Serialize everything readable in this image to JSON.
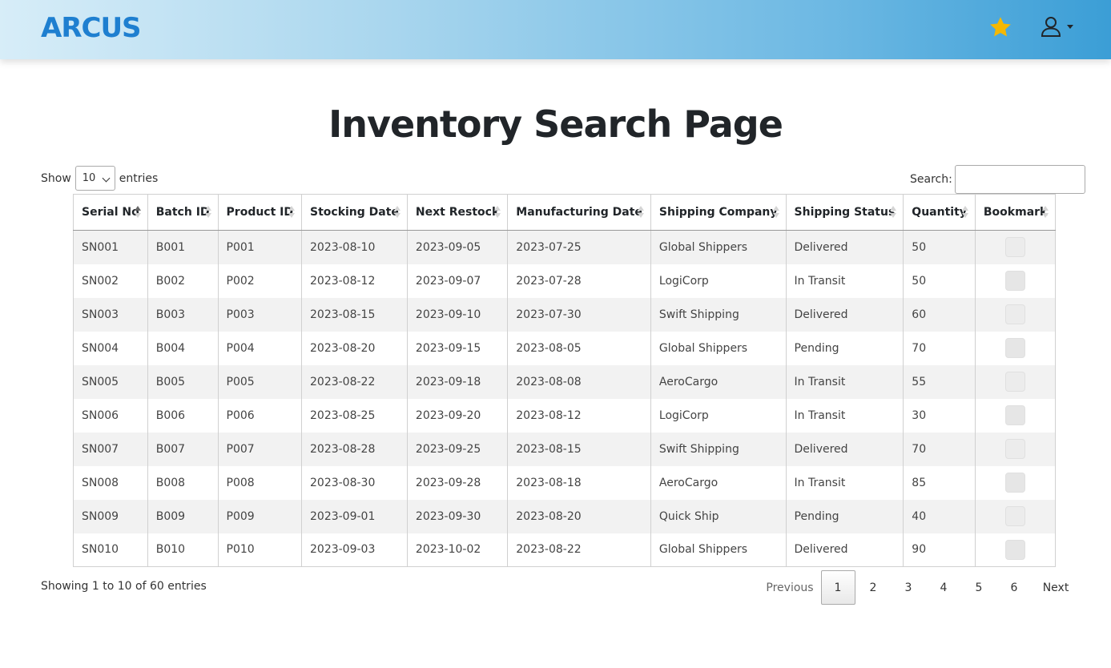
{
  "header": {
    "logo_text": "ARCUS",
    "star_color": "#f5b800",
    "icons": [
      "star-icon",
      "user-icon",
      "caret-down-icon"
    ]
  },
  "page": {
    "title": "Inventory Search Page"
  },
  "length": {
    "show_label": "Show",
    "selected": "10",
    "entries_label": "entries"
  },
  "search": {
    "label": "Search:",
    "value": ""
  },
  "table": {
    "columns": [
      "Serial No",
      "Batch ID",
      "Product ID",
      "Stocking Date",
      "Next Restock",
      "Manufacturing Date",
      "Shipping Company",
      "Shipping Status",
      "Quantity",
      "Bookmark"
    ],
    "sorted_column": "Serial No",
    "sort_direction": "ascending",
    "rows": [
      [
        "SN001",
        "B001",
        "P001",
        "2023-08-10",
        "2023-09-05",
        "2023-07-25",
        "Global Shippers",
        "Delivered",
        "50"
      ],
      [
        "SN002",
        "B002",
        "P002",
        "2023-08-12",
        "2023-09-07",
        "2023-07-28",
        "LogiCorp",
        "In Transit",
        "50"
      ],
      [
        "SN003",
        "B003",
        "P003",
        "2023-08-15",
        "2023-09-10",
        "2023-07-30",
        "Swift Shipping",
        "Delivered",
        "60"
      ],
      [
        "SN004",
        "B004",
        "P004",
        "2023-08-20",
        "2023-09-15",
        "2023-08-05",
        "Global Shippers",
        "Pending",
        "70"
      ],
      [
        "SN005",
        "B005",
        "P005",
        "2023-08-22",
        "2023-09-18",
        "2023-08-08",
        "AeroCargo",
        "In Transit",
        "55"
      ],
      [
        "SN006",
        "B006",
        "P006",
        "2023-08-25",
        "2023-09-20",
        "2023-08-12",
        "LogiCorp",
        "In Transit",
        "30"
      ],
      [
        "SN007",
        "B007",
        "P007",
        "2023-08-28",
        "2023-09-25",
        "2023-08-15",
        "Swift Shipping",
        "Delivered",
        "70"
      ],
      [
        "SN008",
        "B008",
        "P008",
        "2023-08-30",
        "2023-09-28",
        "2023-08-18",
        "AeroCargo",
        "In Transit",
        "85"
      ],
      [
        "SN009",
        "B009",
        "P009",
        "2023-09-01",
        "2023-09-30",
        "2023-08-20",
        "Quick Ship",
        "Pending",
        "40"
      ],
      [
        "SN010",
        "B010",
        "P010",
        "2023-09-03",
        "2023-10-02",
        "2023-08-22",
        "Global Shippers",
        "Delivered",
        "90"
      ]
    ]
  },
  "footer": {
    "info": "Showing 1 to 10 of 60 entries",
    "previous_label": "Previous",
    "next_label": "Next",
    "pages": [
      "1",
      "2",
      "3",
      "4",
      "5",
      "6"
    ],
    "current_page": "1"
  }
}
